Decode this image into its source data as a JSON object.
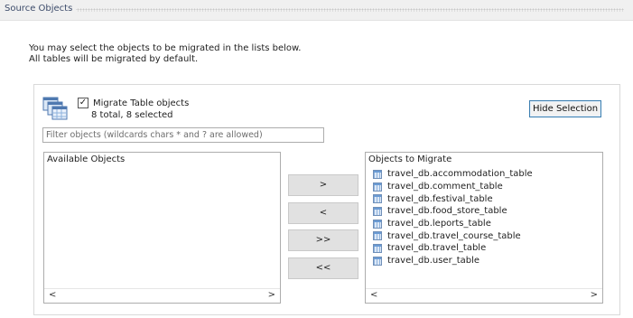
{
  "section": {
    "title": "Source Objects"
  },
  "intro": {
    "line1": "You may select the objects to be migrated in the lists below.",
    "line2": "All tables will be migrated by default."
  },
  "group": {
    "checkbox_label": "Migrate Table objects",
    "checked": "✓",
    "count_text": "8 total, 8 selected",
    "hide_button": "Hide Selection",
    "filter_placeholder": "Filter objects (wildcards chars * and ? are allowed)"
  },
  "available": {
    "title": "Available Objects"
  },
  "migrate": {
    "title": "Objects to Migrate",
    "items": [
      "travel_db.accommodation_table",
      "travel_db.comment_table",
      "travel_db.festival_table",
      "travel_db.food_store_table",
      "travel_db.leports_table",
      "travel_db.travel_course_table",
      "travel_db.travel_table",
      "travel_db.user_table"
    ]
  },
  "buttons": {
    "add": ">",
    "remove": "<",
    "add_all": ">>",
    "remove_all": "<<"
  },
  "scroll": {
    "left": "<",
    "right": ">"
  },
  "icons": {
    "table_group": "table-group-icon",
    "table_item": "table-icon"
  }
}
